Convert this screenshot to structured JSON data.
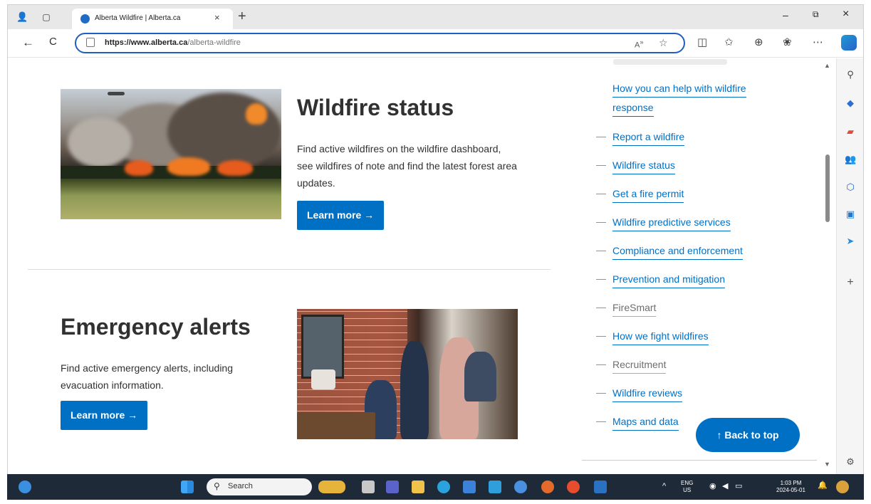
{
  "browser": {
    "tab_title": "Alberta Wildfire | Alberta.ca",
    "tab_close": "×",
    "new_tab": "+",
    "url_host": "https://www.alberta.ca",
    "url_path": "/alberta-wildfire",
    "minimize": "–",
    "restore": "⧉",
    "close": "×",
    "back": "←",
    "reload": "C"
  },
  "sections": {
    "wildfire": {
      "title": "Wildfire status",
      "description": "Find active wildfires on the wildfire dashboard, see wildfires of note and find the latest forest area updates.",
      "button": "Learn more →"
    },
    "emergency": {
      "title": "Emergency alerts",
      "description": "Find active emergency alerts, including evacuation information.",
      "button": "Learn more →"
    }
  },
  "sidenav": {
    "items": [
      {
        "label": "How you can help with wildfire",
        "label2": "response",
        "muted": false
      },
      {
        "label": "Report a wildfire",
        "muted": false
      },
      {
        "label": "Wildfire status",
        "muted": false
      },
      {
        "label": "Get a fire permit",
        "muted": false
      },
      {
        "label": "Wildfire predictive services",
        "muted": false
      },
      {
        "label": "Compliance and enforcement",
        "muted": false
      },
      {
        "label": "Prevention and mitigation",
        "muted": false
      },
      {
        "label": "FireSmart",
        "muted": true
      },
      {
        "label": "How we fight wildfires",
        "muted": false
      },
      {
        "label": "Recruitment",
        "muted": true
      },
      {
        "label": "Wildfire reviews",
        "muted": false
      },
      {
        "label": "Maps and data",
        "muted": false
      }
    ],
    "dash": "—"
  },
  "back_to_top": "↑  Back to top",
  "taskbar": {
    "search_placeholder": "Search",
    "lang_top": "ENG",
    "lang_bottom": "US",
    "time": "1:03 PM",
    "date": "2024-05-01",
    "chevron": "^"
  },
  "colors": {
    "accent": "#0070c4",
    "taskbar": "#1f2a38"
  }
}
